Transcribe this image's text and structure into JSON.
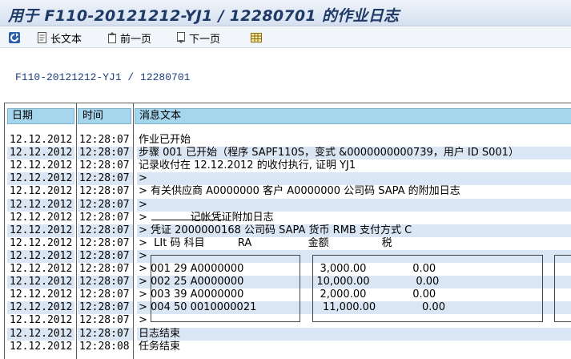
{
  "window": {
    "title": "用于 F110-20121212-YJ1 / 12280701 的作业日志"
  },
  "toolbar": {
    "refresh_icon": "refresh-icon",
    "long_text_label": "长文本",
    "prev_page_label": "前一页",
    "next_page_label": "下一页",
    "grid_icon": "grid-icon"
  },
  "header_path": "F110-20121212-YJ1 / 12280701",
  "table": {
    "columns": [
      "日期",
      "时间",
      "消息文本"
    ],
    "rows": [
      {
        "date": "12.12.2012",
        "time": "12:28:07",
        "msg": "作业已开始"
      },
      {
        "date": "12.12.2012",
        "time": "12:28:07",
        "msg": "步骤 001 已开始（程序 SAPF110S，变式 &0000000000739，用户 ID S001）"
      },
      {
        "date": "12.12.2012",
        "time": "12:28:07",
        "msg": "记录收付在 12.12.2012 的收付执行, 证明 YJ1"
      },
      {
        "date": "12.12.2012",
        "time": "12:28:07",
        "msg": ">"
      },
      {
        "date": "12.12.2012",
        "time": "12:28:07",
        "msg": "> 有关供应商 A0000000 客户 A0000000 公司码 SAPA 的附加日志"
      },
      {
        "date": "12.12.2012",
        "time": "12:28:07",
        "msg": ">"
      },
      {
        "date": "12.12.2012",
        "time": "12:28:07",
        "msg": ">             记帐凭证附加日志"
      },
      {
        "date": "12.12.2012",
        "time": "12:28:07",
        "msg": "> 凭证 2000000168 公司码 SAPA 货币 RMB 支付方式 C"
      },
      {
        "date": "12.12.2012",
        "time": "12:28:07",
        "msg": ">  LIt 码 科目          RA                 金额                税"
      },
      {
        "date": "12.12.2012",
        "time": "12:28:07",
        "msg": ">"
      },
      {
        "date": "12.12.2012",
        "time": "12:28:07",
        "msg": "> 001 29 A0000000                       3,000.00              0.00"
      },
      {
        "date": "12.12.2012",
        "time": "12:28:07",
        "msg": "> 002 25 A0000000                      10,000.00              0.00"
      },
      {
        "date": "12.12.2012",
        "time": "12:28:07",
        "msg": "> 003 39 A0000000                       2,000.00              0.00"
      },
      {
        "date": "12.12.2012",
        "time": "12:28:07",
        "msg": "> 004 50 0010000021                    11,000.00              0.00"
      },
      {
        "date": "12.12.2012",
        "time": "12:28:07",
        "msg": ">"
      },
      {
        "date": "12.12.2012",
        "time": "12:28:07",
        "msg": "日志结束"
      },
      {
        "date": "12.12.2012",
        "time": "12:28:08",
        "msg": "任务结束"
      }
    ]
  },
  "colors": {
    "header_bg": "#a6d6ee",
    "alt_row_bg": "#dbe6f4",
    "title_color": "#1f3a67"
  }
}
